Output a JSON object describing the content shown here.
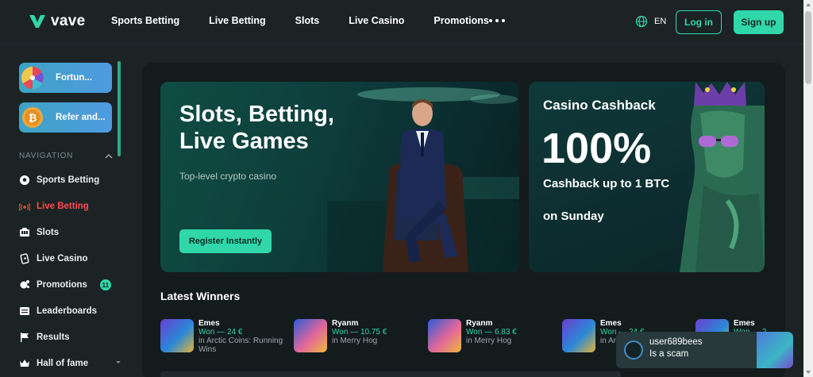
{
  "brand": {
    "logo_text": "vave",
    "accent": "#2fd7a9"
  },
  "header": {
    "nav": [
      "Sports Betting",
      "Live Betting",
      "Slots",
      "Live Casino",
      "Promotions"
    ],
    "more_icon": "more-dots-icon",
    "language": "EN",
    "login_label": "Log in",
    "signup_label": "Sign up"
  },
  "sidebar": {
    "promo_cards": [
      {
        "label": "Fortun...",
        "icon": "fortune-wheel-icon"
      },
      {
        "label": "Refer and...",
        "icon": "bitcoin-coin-icon"
      }
    ],
    "nav_heading": "NAVIGATION",
    "items": [
      {
        "label": "Sports Betting",
        "icon": "soccer-ball-icon"
      },
      {
        "label": "Live Betting",
        "icon": "live-signal-icon",
        "active": true
      },
      {
        "label": "Slots",
        "icon": "slot-machine-icon"
      },
      {
        "label": "Live Casino",
        "icon": "playing-card-icon"
      },
      {
        "label": "Promotions",
        "icon": "promotions-icon",
        "badge": "11"
      },
      {
        "label": "Leaderboards",
        "icon": "leaderboard-icon"
      },
      {
        "label": "Results",
        "icon": "flag-icon"
      },
      {
        "label": "Hall of fame",
        "icon": "crown-icon"
      }
    ]
  },
  "hero": {
    "title": "Slots, Betting, Live Games",
    "subtitle": "Top-level crypto casino",
    "cta_label": "Register Instantly"
  },
  "cashback": {
    "title": "Casino Cashback",
    "percent": "100%",
    "line1": "Cashback up to 1 BTC",
    "line2": "on Sunday"
  },
  "winners": {
    "title": "Latest Winners",
    "items": [
      {
        "name": "Emes",
        "amount": "Won — 24 €",
        "game": "in Arctic Coins: Running Wins",
        "thumb": "arctic"
      },
      {
        "name": "Ryanm",
        "amount": "Won — 10.75 €",
        "game": "in Merry Hog",
        "thumb": "hog"
      },
      {
        "name": "Ryanm",
        "amount": "Won — 6.83 €",
        "game": "in Merry Hog",
        "thumb": "hog"
      },
      {
        "name": "Emes",
        "amount": "Won — 24 €",
        "game": "in Arc Win",
        "thumb": "arctic"
      },
      {
        "name": "Emes",
        "amount": "Won — 2",
        "game": "",
        "thumb": "arctic"
      }
    ]
  },
  "toast": {
    "user": "user689bees",
    "message": "Is a scam"
  }
}
